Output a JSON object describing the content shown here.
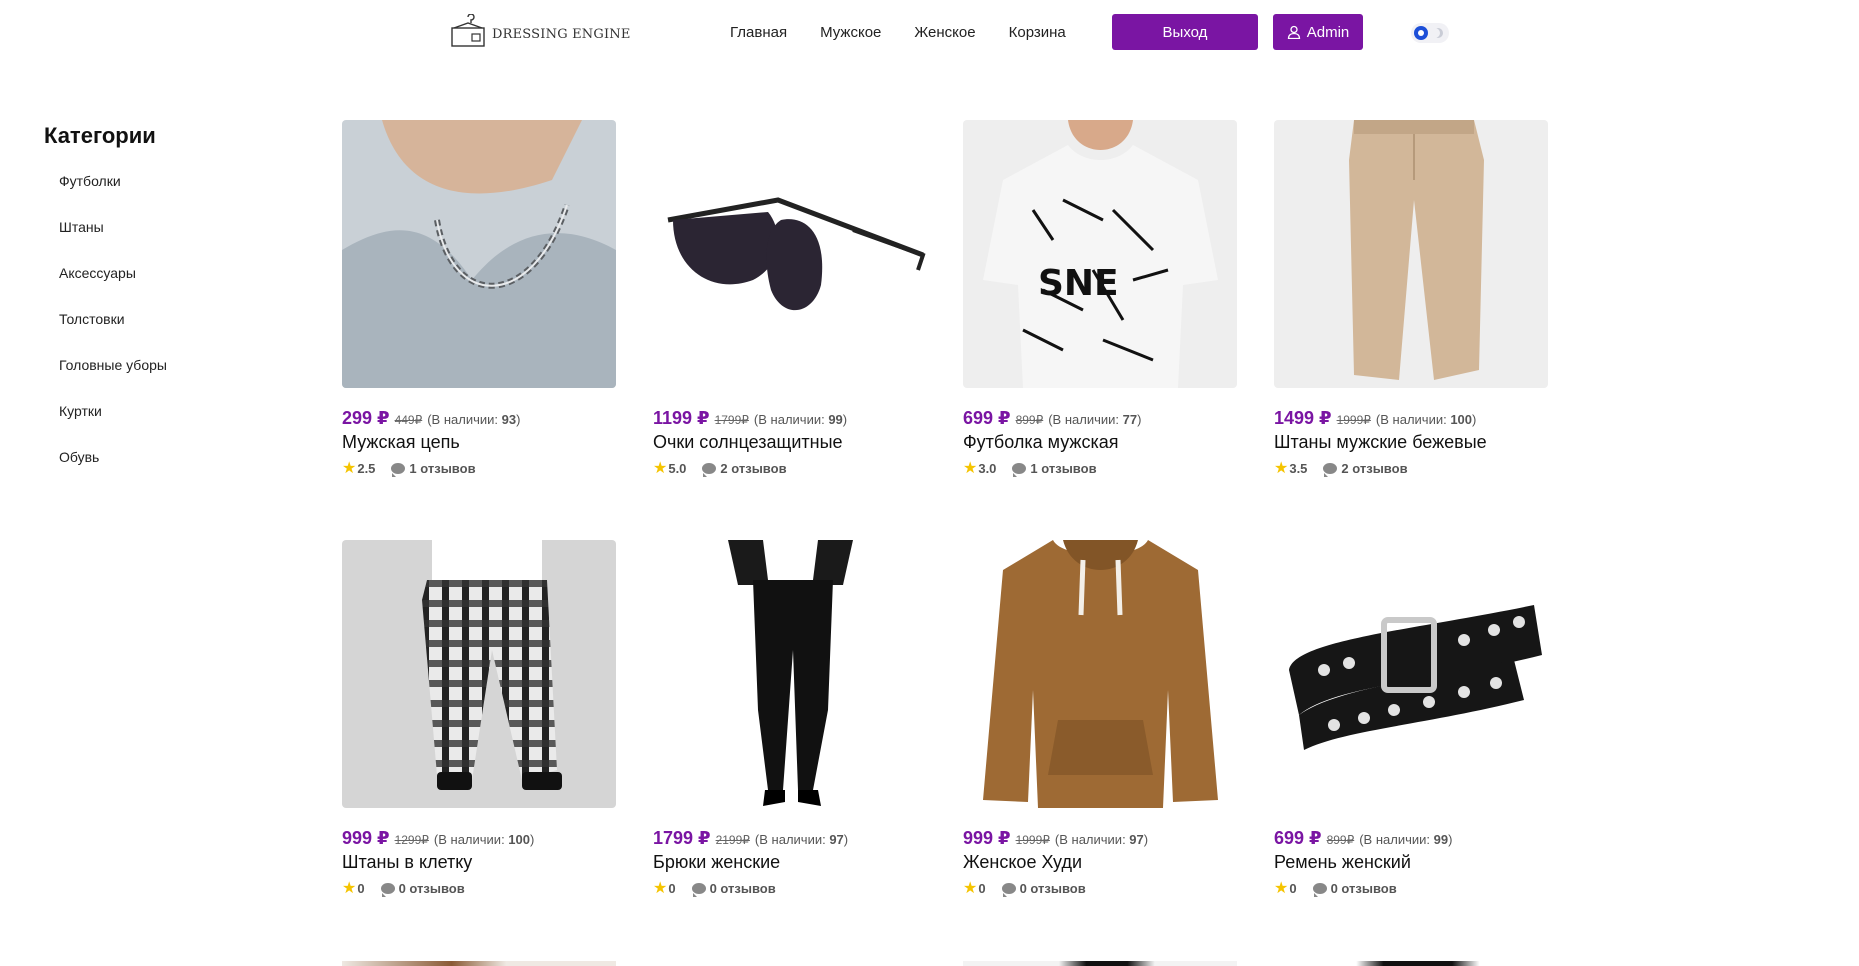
{
  "header": {
    "logo_text": "DRESSING ENGINE",
    "nav": [
      "Главная",
      "Мужское",
      "Женское",
      "Корзина"
    ],
    "logout_label": "Выход",
    "admin_label": "Admin"
  },
  "sidebar": {
    "title": "Категории",
    "items": [
      "Футболки",
      "Штаны",
      "Аксессуары",
      "Толстовки",
      "Головные уборы",
      "Куртки",
      "Обувь"
    ]
  },
  "colors": {
    "accent": "#7a15a3",
    "star": "#f5c400",
    "toggle": "#1d4fd8"
  },
  "currency": "₽",
  "stock_prefix": "(В наличии: ",
  "stock_suffix": ")",
  "reviews_suffix": "отзывов",
  "products": [
    {
      "price": "299 ₽",
      "old_price": "449₽",
      "stock": "93",
      "name": "Мужская цепь",
      "rating": "2.5",
      "reviews": "1 отзывов",
      "image": "necklace"
    },
    {
      "price": "1199 ₽",
      "old_price": "1799₽",
      "stock": "99",
      "name": "Очки солнцезащитные",
      "rating": "5.0",
      "reviews": "2 отзывов",
      "image": "sunglasses"
    },
    {
      "price": "699 ₽",
      "old_price": "899₽",
      "stock": "77",
      "name": "Футболка мужская",
      "rating": "3.0",
      "reviews": "1 отзывов",
      "image": "tshirt"
    },
    {
      "price": "1499 ₽",
      "old_price": "1999₽",
      "stock": "100",
      "name": "Штаны мужские бежевые",
      "rating": "3.5",
      "reviews": "2 отзывов",
      "image": "beige-pants"
    },
    {
      "price": "999 ₽",
      "old_price": "1299₽",
      "stock": "100",
      "name": "Штаны в клетку",
      "rating": "0",
      "reviews": "0 отзывов",
      "image": "plaid-pants"
    },
    {
      "price": "1799 ₽",
      "old_price": "2199₽",
      "stock": "97",
      "name": "Брюки женские",
      "rating": "0",
      "reviews": "0 отзывов",
      "image": "black-trousers"
    },
    {
      "price": "999 ₽",
      "old_price": "1999₽",
      "stock": "97",
      "name": "Женское Худи",
      "rating": "0",
      "reviews": "0 отзывов",
      "image": "hoodie"
    },
    {
      "price": "699 ₽",
      "old_price": "899₽",
      "stock": "99",
      "name": "Ремень женский",
      "rating": "0",
      "reviews": "0 отзывов",
      "image": "belt"
    }
  ]
}
